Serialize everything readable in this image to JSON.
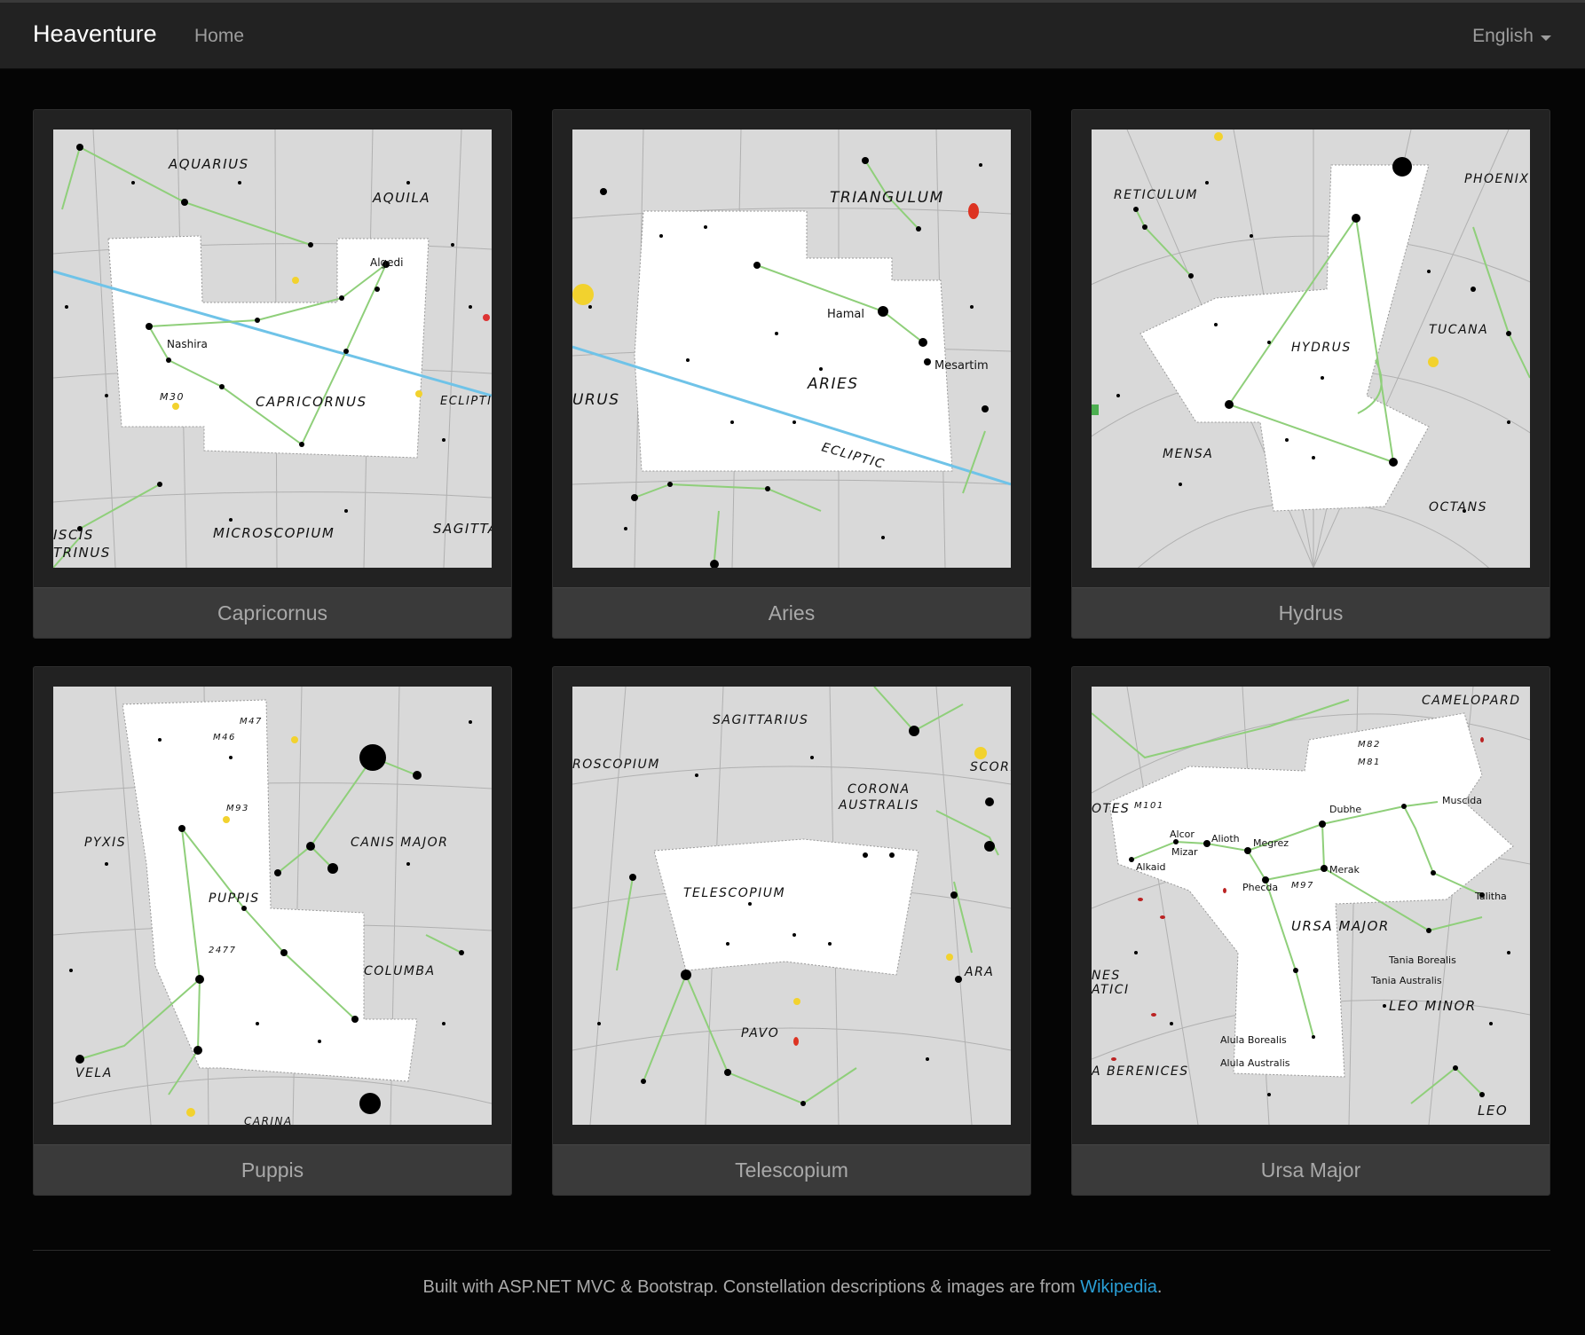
{
  "navbar": {
    "brand": "Heaventure",
    "home": "Home",
    "language": "English"
  },
  "constellations": [
    {
      "name": "Capricornus",
      "labels": [
        "AQUARIUS",
        "AQUILA",
        "CAPRICORNUS",
        "MICROSCOPIUM",
        "Algedi",
        "Nashira",
        "M30",
        "ECLIPTIC",
        "ISCIS",
        "TRINUS",
        "SAGITTA"
      ]
    },
    {
      "name": "Aries",
      "labels": [
        "TRIANGULUM",
        "Hamal",
        "ARIES",
        "Mesartim",
        "ECLIPTIC",
        "URUS"
      ]
    },
    {
      "name": "Hydrus",
      "labels": [
        "RETICULUM",
        "PHOENIX",
        "TUCANA",
        "HYDRUS",
        "MENSA",
        "OCTANS"
      ]
    },
    {
      "name": "Puppis",
      "labels": [
        "PYXIS",
        "CANIS MAJOR",
        "PUPPIS",
        "COLUMBA",
        "VELA",
        "M47",
        "M46",
        "M93",
        "2477",
        "CARINA"
      ]
    },
    {
      "name": "Telescopium",
      "labels": [
        "SAGITTARIUS",
        "ROSCOPIUM",
        "CORONA",
        "AUSTRALIS",
        "TELESCOPIUM",
        "ARA",
        "PAVO",
        "SCORP"
      ]
    },
    {
      "name": "Ursa Major",
      "labels": [
        "CAMELOPARD",
        "URSA MAJOR",
        "LEO MINOR",
        "LEO",
        "Dubhe",
        "Merak",
        "Phecda",
        "Megrez",
        "Alioth",
        "Mizar",
        "Alcor",
        "Alkaid",
        "Muscida",
        "Talitha",
        "Tania Borealis",
        "Tania Australis",
        "Alula Borealis",
        "Alula Australis",
        "M82",
        "M81",
        "M97",
        "M101",
        "OTES",
        "NES",
        "ATICI",
        "A BERENICES"
      ]
    }
  ],
  "footer": {
    "text": "Built with ASP.NET MVC & Bootstrap. Constellation descriptions & images are from ",
    "link": "Wikipedia",
    "suffix": "."
  },
  "colors": {
    "navbar": "#222222",
    "background": "#050505",
    "card": "#222222",
    "caption": "#3a3a3a",
    "link": "#2a9fd6",
    "ecliptic": "#6fc3e8",
    "figure_line": "#8fcf7a"
  }
}
